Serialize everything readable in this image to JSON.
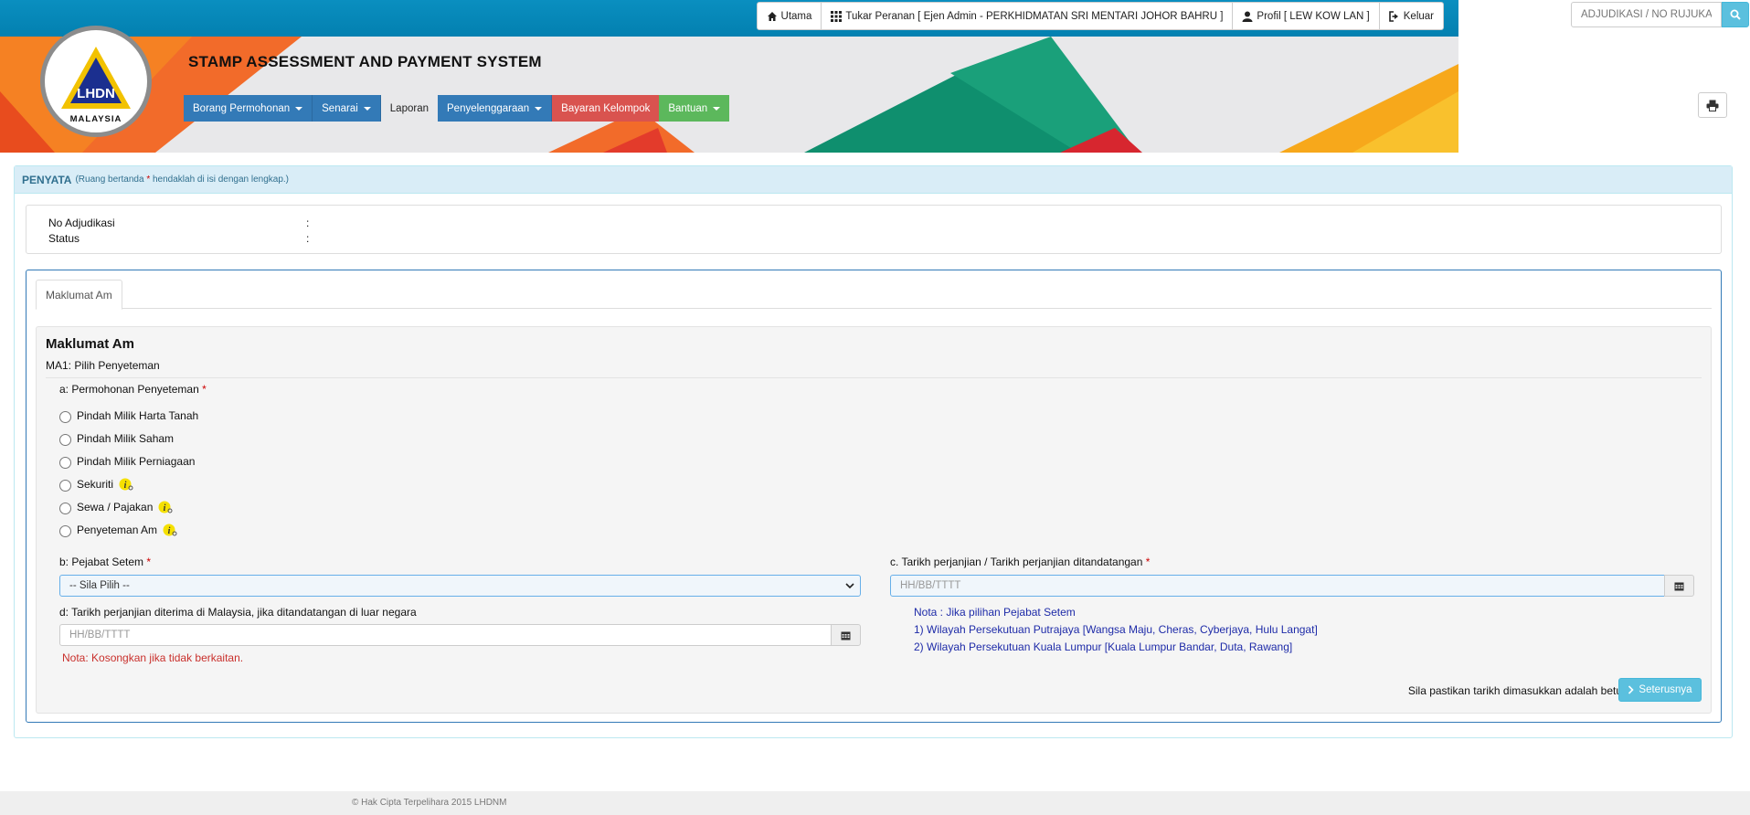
{
  "topnav": {
    "home": "Utama",
    "role": "Tukar Peranan [ Ejen Admin - PERKHIDMATAN SRI MENTARI JOHOR BAHRU ]",
    "profile": "Profil [ LEW KOW LAN ]",
    "logout": "Keluar"
  },
  "search": {
    "placeholder": "ADJUDIKASI / NO RUJUKAN"
  },
  "logo": {
    "text_top": "LHDN",
    "text_bottom": "MALAYSIA"
  },
  "app_title": "STAMP ASSESSMENT AND PAYMENT SYSTEM",
  "mainnav": {
    "borang": "Borang Permohonan",
    "senarai": "Senarai",
    "laporan": "Laporan",
    "penyelenggaraan": "Penyelenggaraan",
    "bayaran": "Bayaran Kelompok",
    "bantuan": "Bantuan"
  },
  "panel": {
    "title": "PENYATA",
    "subtitle_pre": "(Ruang bertanda",
    "subtitle_star": "*",
    "subtitle_post": "hendaklah di isi dengan lengkap.)"
  },
  "info": {
    "adjudikasi_label": "No Adjudikasi",
    "status_label": "Status",
    "colon": ":"
  },
  "tab": {
    "label": "Maklumat Am"
  },
  "form": {
    "section_title": "Maklumat Am",
    "section_sub": "MA1: Pilih Penyeteman",
    "q_a": "a: Permohonan Penyeteman",
    "star": "*",
    "options": [
      "Pindah Milik Harta Tanah",
      "Pindah Milik Saham",
      "Pindah Milik Perniagaan",
      "Sekuriti",
      "Sewa / Pajakan",
      "Penyeteman Am"
    ],
    "q_b": "b: Pejabat Setem",
    "select_value": "-- Sila Pilih --",
    "q_c": "c. Tarikh perjanjian / Tarikh perjanjian ditandatangan",
    "date_placeholder": "HH/BB/TTTT",
    "q_d": "d: Tarikh perjanjian diterima di Malaysia, jika ditandatangan di luar negara",
    "nota_red": "Nota: Kosongkan jika tidak berkaitan.",
    "nota_blue_1": "Nota : Jika pilihan Pejabat Setem",
    "nota_blue_2": "1) Wilayah Persekutuan Putrajaya [Wangsa Maju, Cheras, Cyberjaya, Hulu Langat]",
    "nota_blue_3": "2) Wilayah Persekutuan Kuala Lumpur [Kuala Lumpur Bandar, Duta, Rawang]",
    "confirm_text": "Sila pastikan tarikh dimasukkan adalah betul.",
    "next_button": "Seterusnya"
  },
  "footer": "© Hak Cipta Terpelihara 2015 LHDNM"
}
